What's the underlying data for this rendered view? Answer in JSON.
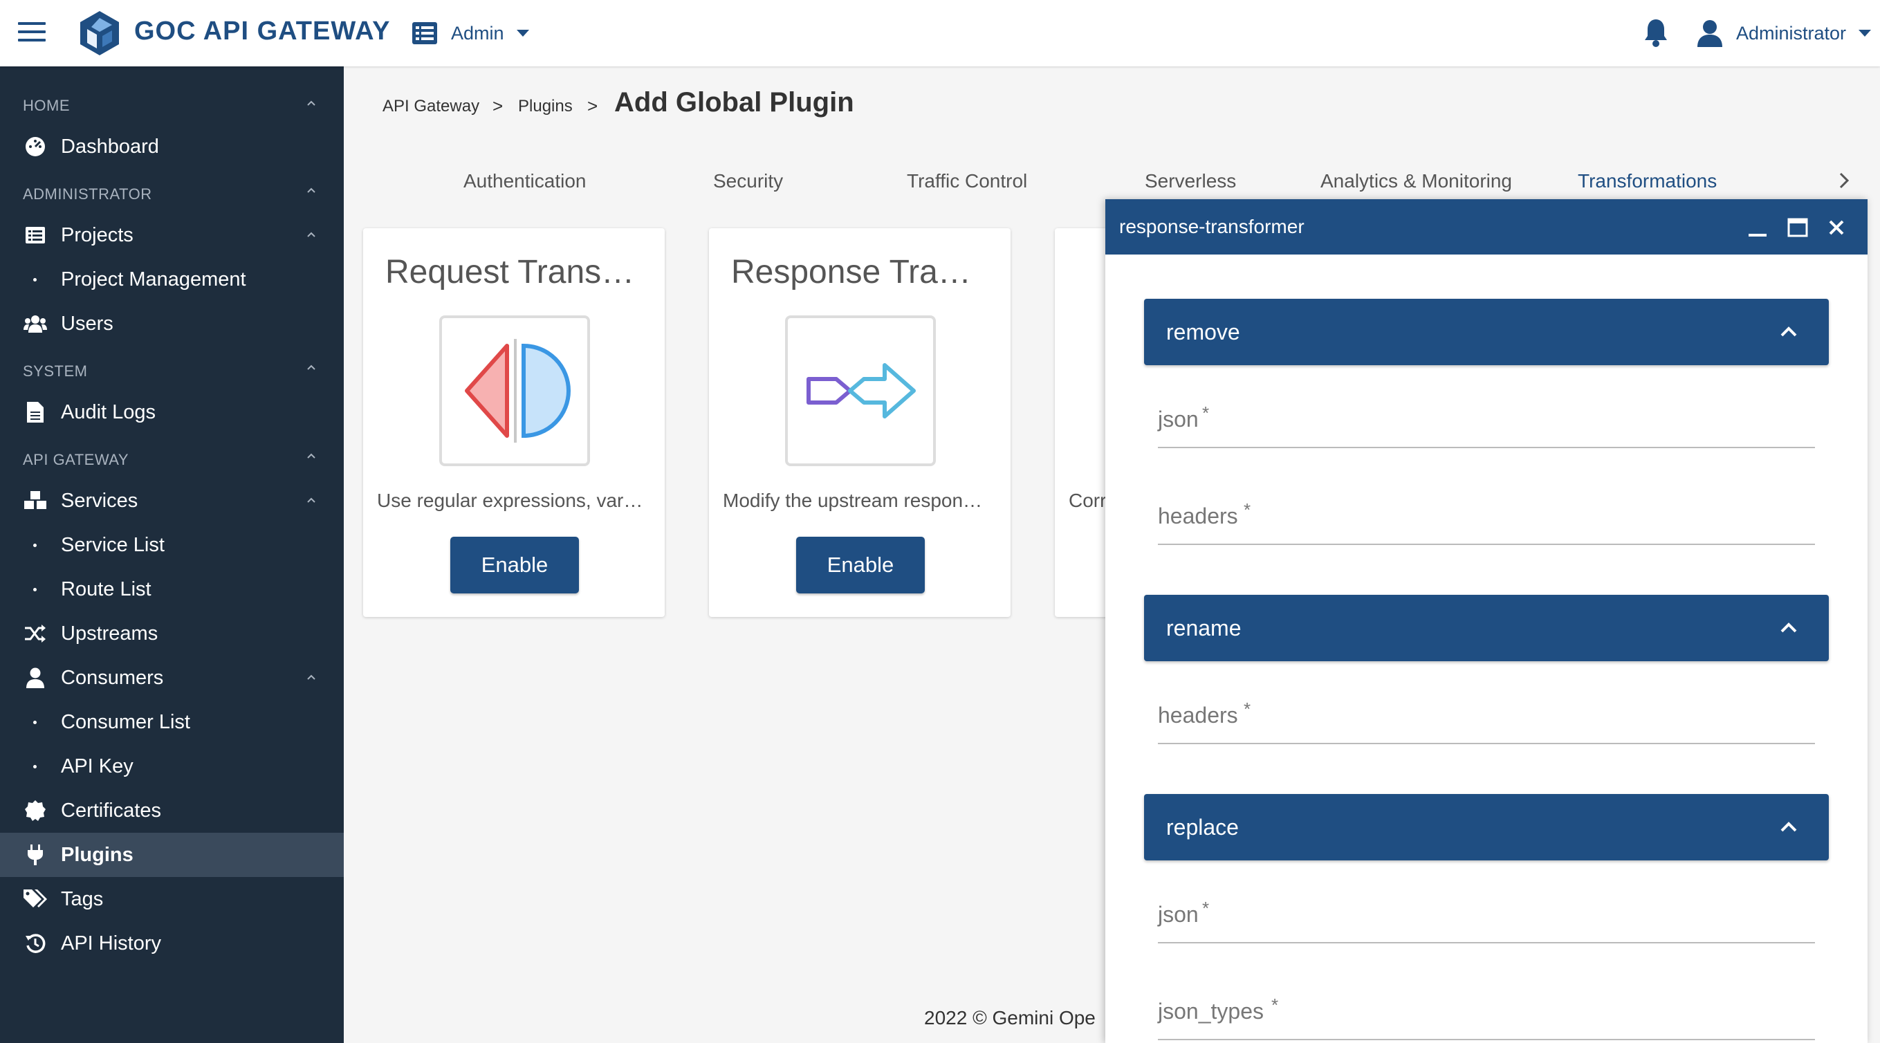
{
  "header": {
    "app_title": "GOC API GATEWAY",
    "workspace_label": "Admin",
    "user_label": "Administrator"
  },
  "sidebar": {
    "sections": [
      {
        "label": "HOME"
      },
      {
        "label": "ADMINISTRATOR"
      },
      {
        "label": "SYSTEM"
      },
      {
        "label": "API GATEWAY"
      }
    ],
    "items": [
      {
        "label": "Dashboard",
        "icon": "dashboard-icon"
      },
      {
        "label": "Projects",
        "icon": "list-icon"
      },
      {
        "label": "Project Management",
        "icon": "dot"
      },
      {
        "label": "Users",
        "icon": "users-icon"
      },
      {
        "label": "Audit Logs",
        "icon": "file-icon"
      },
      {
        "label": "Services",
        "icon": "cubes-icon"
      },
      {
        "label": "Service List",
        "icon": "dot"
      },
      {
        "label": "Route List",
        "icon": "dot"
      },
      {
        "label": "Upstreams",
        "icon": "shuffle-icon"
      },
      {
        "label": "Consumers",
        "icon": "user-icon"
      },
      {
        "label": "Consumer List",
        "icon": "dot"
      },
      {
        "label": "API Key",
        "icon": "dot"
      },
      {
        "label": "Certificates",
        "icon": "certificate-icon"
      },
      {
        "label": "Plugins",
        "icon": "plug-icon",
        "active": true
      },
      {
        "label": "Tags",
        "icon": "tags-icon"
      },
      {
        "label": "API History",
        "icon": "history-icon"
      }
    ]
  },
  "breadcrumb": {
    "items": [
      "API Gateway",
      "Plugins"
    ],
    "separator": ">",
    "current": "Add Global Plugin"
  },
  "tabs": [
    {
      "label": "Authentication"
    },
    {
      "label": "Security"
    },
    {
      "label": "Traffic Control"
    },
    {
      "label": "Serverless"
    },
    {
      "label": "Analytics & Monitoring"
    },
    {
      "label": "Transformations",
      "active": true
    }
  ],
  "cards": [
    {
      "title": "Request Trans…",
      "description": "Use regular expressions, var…",
      "button": "Enable"
    },
    {
      "title": "Response Tra…",
      "description": "Modify the upstream respon…",
      "button": "Enable"
    },
    {
      "title": "",
      "description": "Corr",
      "button": ""
    }
  ],
  "footer": {
    "text": "2022 © Gemini Ope"
  },
  "dialog": {
    "title": "response-transformer",
    "sections": [
      {
        "label": "remove",
        "fields": [
          "json",
          "headers"
        ]
      },
      {
        "label": "rename",
        "fields": [
          "headers"
        ]
      },
      {
        "label": "replace",
        "fields": [
          "json",
          "json_types"
        ]
      }
    ],
    "required_mark": "*"
  },
  "colors": {
    "brand": "#1f4e82",
    "sidebar_bg": "#1e2d3d",
    "sidebar_active": "#3a4a5c",
    "page_bg": "#f5f5f5"
  }
}
